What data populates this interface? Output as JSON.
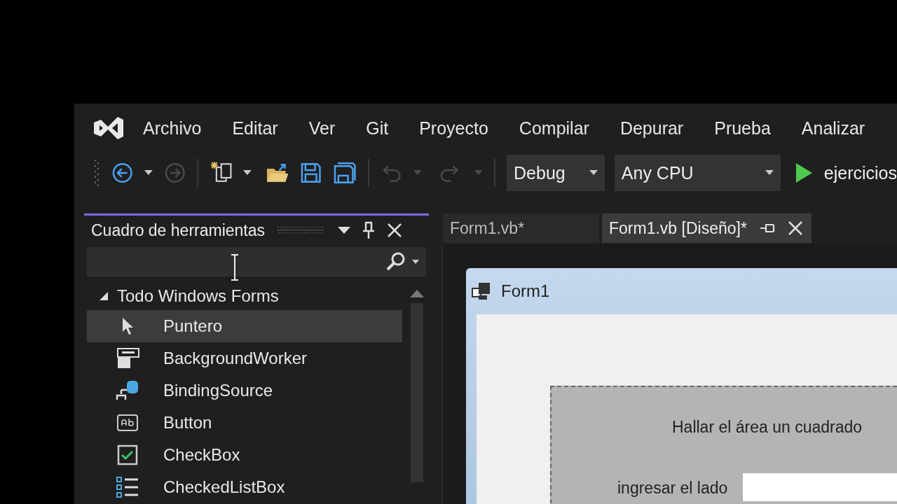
{
  "menu": [
    {
      "label": "Archivo"
    },
    {
      "label": "Editar"
    },
    {
      "label": "Ver"
    },
    {
      "label": "Git"
    },
    {
      "label": "Proyecto"
    },
    {
      "label": "Compilar"
    },
    {
      "label": "Depurar"
    },
    {
      "label": "Prueba"
    },
    {
      "label": "Analizar"
    }
  ],
  "toolbar": {
    "configuration": "Debug",
    "platform": "Any CPU",
    "run_target": "ejercicios"
  },
  "toolbox": {
    "title": "Cuadro de herramientas",
    "group": {
      "label": "Todo Windows Forms",
      "expanded": true,
      "items": [
        {
          "label": "Puntero",
          "kind": "pointer",
          "selected": true
        },
        {
          "label": "BackgroundWorker",
          "kind": "worker",
          "selected": false
        },
        {
          "label": "BindingSource",
          "kind": "binding",
          "selected": false
        },
        {
          "label": "Button",
          "kind": "button",
          "selected": false
        },
        {
          "label": "CheckBox",
          "kind": "checkbox",
          "selected": false
        },
        {
          "label": "CheckedListBox",
          "kind": "checklist",
          "selected": false
        }
      ]
    }
  },
  "tabs": [
    {
      "label": "Form1.vb*",
      "selected": false
    },
    {
      "label": "Form1.vb [Diseño]*",
      "selected": true
    }
  ],
  "form": {
    "title": "Form1",
    "heading": "Hallar el área un cuadrado",
    "field_label": "ingresar el lado"
  }
}
